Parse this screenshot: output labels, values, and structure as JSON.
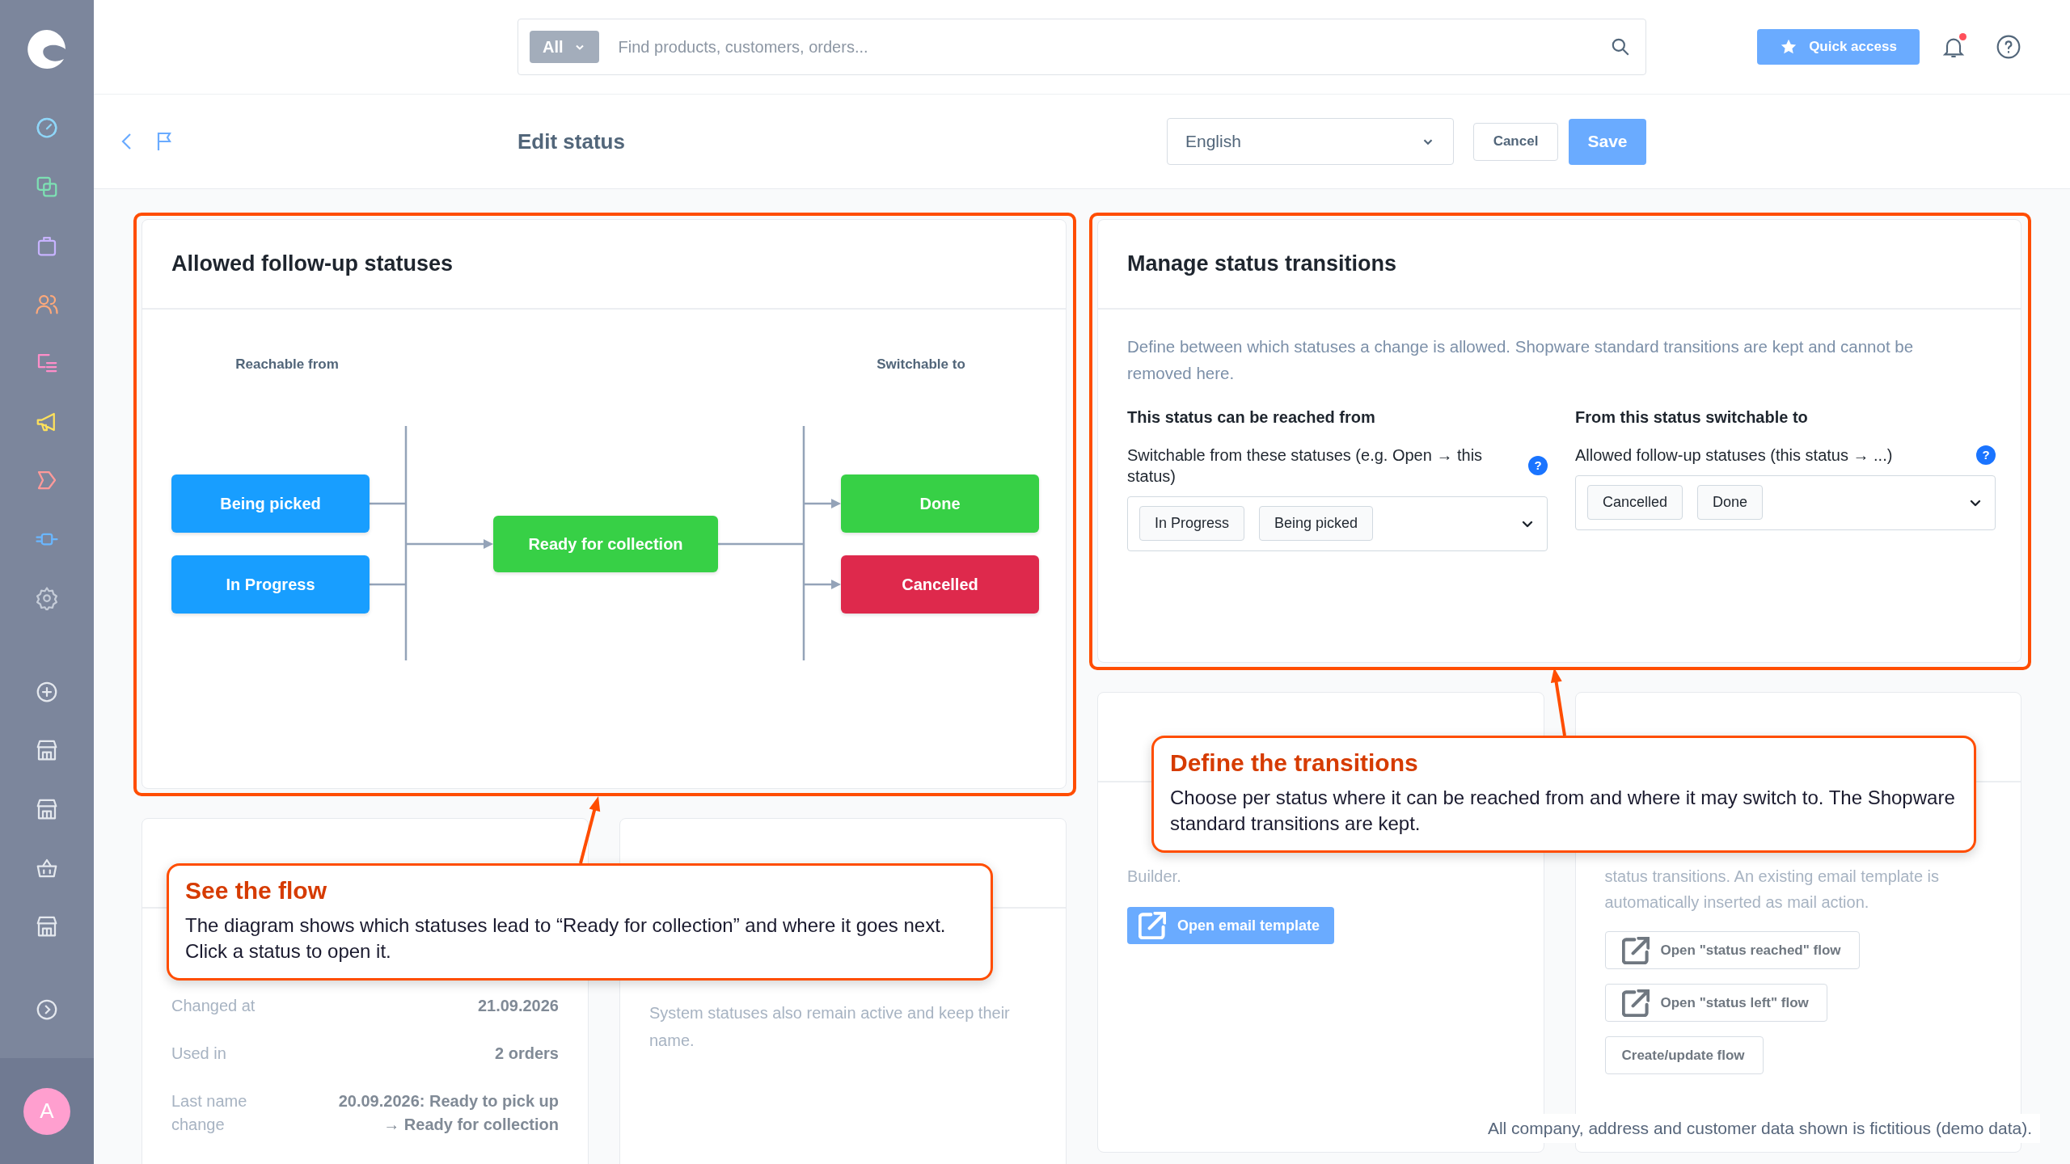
{
  "user": {
    "initial": "A"
  },
  "search": {
    "scope": "All",
    "placeholder": "Find products, customers, orders..."
  },
  "header": {
    "quick_access": "Quick access",
    "has_notifications": true
  },
  "page": {
    "title": "Edit status",
    "language": "English",
    "cancel": "Cancel",
    "save": "Save"
  },
  "follow_up_card": {
    "title": "Allowed follow-up statuses",
    "highlighted": true,
    "from_label": "Reachable from",
    "to_label": "Switchable to",
    "sources": [
      {
        "label": "Being picked",
        "color": "#189eff"
      },
      {
        "label": "In Progress",
        "color": "#189eff"
      }
    ],
    "current": {
      "label": "Ready for collection",
      "color": "#37d046"
    },
    "targets": [
      {
        "label": "Done",
        "color": "#37d046"
      },
      {
        "label": "Cancelled",
        "color": "#de294c"
      }
    ]
  },
  "transitions_card": {
    "title": "Manage status transitions",
    "highlighted": true,
    "description": "Define between which statuses a change is allowed. Shopware standard transitions are kept and cannot be removed here.",
    "columns": [
      {
        "heading": "This status can be reached from",
        "label": "Switchable from these statuses (e.g. Open → this status)",
        "hint_icon": "?",
        "tags": [
          "In Progress",
          "Being picked"
        ]
      },
      {
        "heading": "From this status switchable to",
        "label": "Allowed follow-up statuses (this status → ...)",
        "hint_icon": "?",
        "tags": [
          "Cancelled",
          "Done"
        ]
      }
    ]
  },
  "info_card": {
    "rows": [
      {
        "label": "Changed at",
        "value": [
          "21.09.2026"
        ]
      },
      {
        "label": "Used in",
        "value": [
          "2 orders"
        ]
      },
      {
        "label": "Last name change",
        "value": [
          "20.09.2026: Ready to pick up",
          "→ Ready for collection"
        ]
      }
    ]
  },
  "note_card": {
    "text": "System statuses also remain active and keep their name."
  },
  "email_card": {
    "text": "Builder.",
    "button": "Open email template"
  },
  "flow_card": {
    "text": "status transitions. An existing email template is automatically inserted as mail action.",
    "buttons": [
      {
        "label": "Open \"status reached\" flow",
        "kind": "external"
      },
      {
        "label": "Open \"status left\" flow",
        "kind": "external"
      },
      {
        "label": "Create/update flow",
        "kind": "plain"
      }
    ]
  },
  "callouts": [
    {
      "title": "See the flow",
      "body": "The diagram shows which statuses lead to “Ready for collection” and where it goes next. Click a status to open it."
    },
    {
      "title": "Define the transitions",
      "body": "Choose per status where it can be reached from and where it may switch to. The Shopware standard transitions are kept."
    }
  ],
  "footer_note": "All company, address and customer data shown is fictitious (demo data)."
}
